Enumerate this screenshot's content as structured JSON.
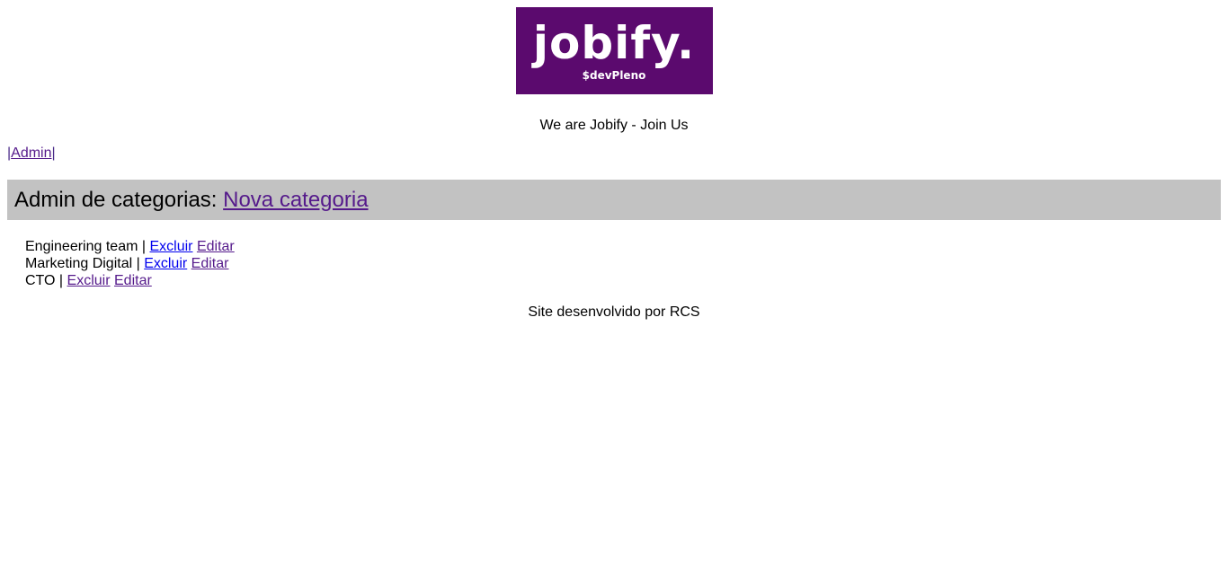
{
  "logo": {
    "word": "jobify.",
    "sub": "$devPleno",
    "bg_color": "#5b0a6e"
  },
  "tagline": "We are Jobify - Join Us",
  "nav": {
    "pipe_left": "|",
    "admin_link": "Admin",
    "pipe_right": "|"
  },
  "admin_bar": {
    "title": "Admin de categorias: ",
    "new_link": "Nova categoria",
    "bg_color": "#c2c2c2"
  },
  "categories": [
    {
      "name": "Engineering team",
      "separator": " | ",
      "delete": "Excluir",
      "edit": "Editar"
    },
    {
      "name": "Marketing Digital",
      "separator": " | ",
      "delete": "Excluir",
      "edit": "Editar"
    },
    {
      "name": "CTO",
      "separator": " | ",
      "delete": "Excluir",
      "edit": "Editar"
    }
  ],
  "footer": "Site desenvolvido por RCS"
}
